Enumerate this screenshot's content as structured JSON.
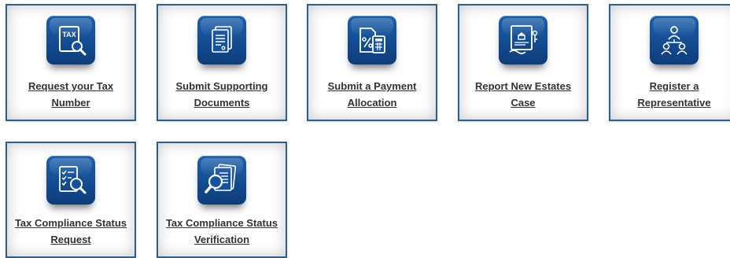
{
  "tiles": [
    {
      "label": "Request your Tax Number",
      "icon": "tax-document-search-icon"
    },
    {
      "label": "Submit Supporting Documents",
      "icon": "documents-icon"
    },
    {
      "label": "Submit a Payment Allocation",
      "icon": "percent-calculator-icon"
    },
    {
      "label": "Report New Estates Case",
      "icon": "estate-certificate-icon"
    },
    {
      "label": "Register a Representative",
      "icon": "people-hierarchy-icon"
    },
    {
      "label": "Tax Compliance Status Request",
      "icon": "checklist-search-icon"
    },
    {
      "label": "Tax Compliance Status Verification",
      "icon": "documents-magnifier-icon"
    }
  ],
  "icon_texts": {
    "tax": "TAX"
  },
  "colors": {
    "tile_border": "#2c5f8a",
    "icon_bg": "#1451a0",
    "label_text": "#333333"
  }
}
